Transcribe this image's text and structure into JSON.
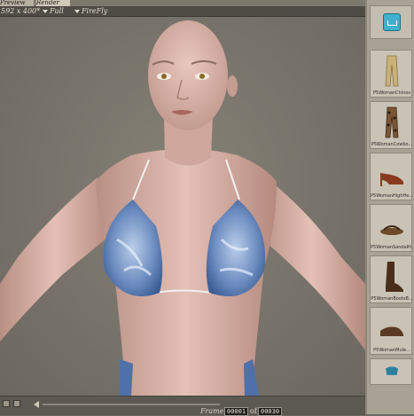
{
  "tabs": {
    "preview": "Preview",
    "render": "Render"
  },
  "toolbar": {
    "size": "592 x 400*",
    "mode": "Full",
    "renderer": "FireFly"
  },
  "library": {
    "items": [
      {
        "label": "P5WomanChinos",
        "icon": "pants-icon",
        "color": "#c8b27a"
      },
      {
        "label": "P5WomanCowbo...",
        "icon": "leopard-pants-icon",
        "color": "#5a4028"
      },
      {
        "label": "P5WomanHighHe...",
        "icon": "high-heel-icon",
        "color": "#8a3a1e"
      },
      {
        "label": "P5WomanSandalH...",
        "icon": "sandal-icon",
        "color": "#6e4a2a"
      },
      {
        "label": "P5WomanBootsB...",
        "icon": "boots-icon",
        "color": "#4a2e1c"
      },
      {
        "label": "P5WomanMule...",
        "icon": "mule-icon",
        "color": "#5a3a22"
      }
    ]
  },
  "timeline": {
    "frame_label": "Frame",
    "current_frame": "00001",
    "of": "of",
    "total_frames": "00030"
  }
}
